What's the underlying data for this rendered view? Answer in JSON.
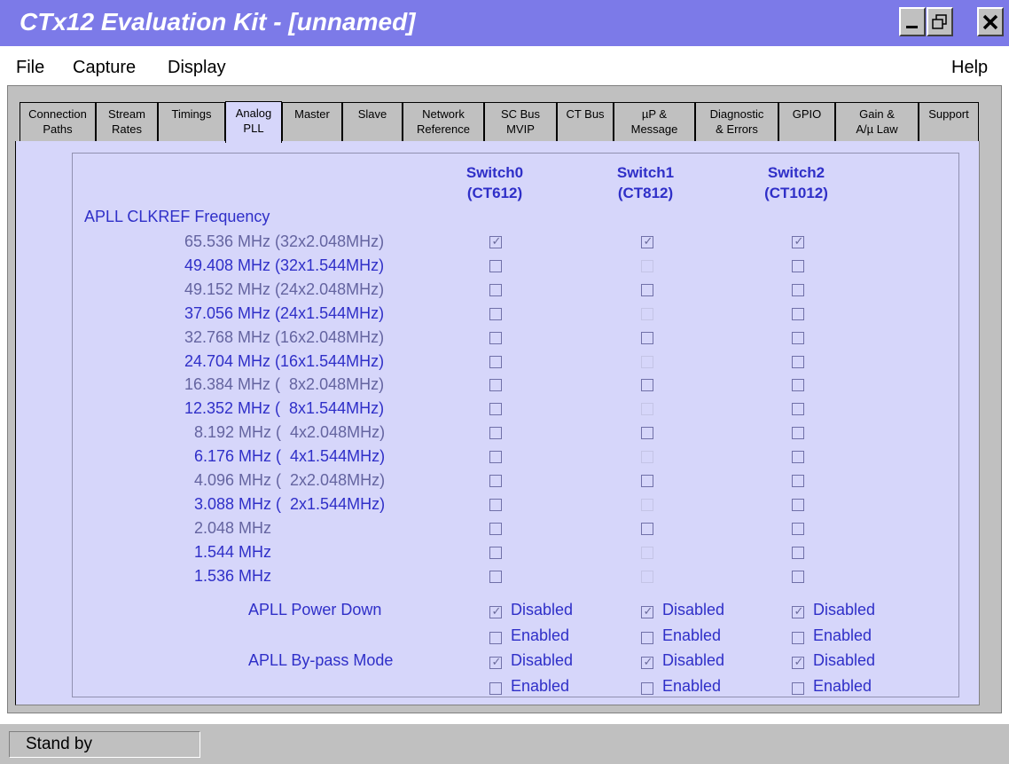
{
  "window": {
    "title": "CTx12 Evaluation Kit - [unnamed]",
    "minimize_icon": "minimize-icon",
    "restore_icon": "restore-icon",
    "close_icon": "close-icon"
  },
  "menu": {
    "file": "File",
    "capture": "Capture",
    "display": "Display",
    "help": "Help"
  },
  "tabs": [
    {
      "label": "Connection\nPaths"
    },
    {
      "label": "Stream\nRates"
    },
    {
      "label": "Timings"
    },
    {
      "label": "Analog\nPLL",
      "active": true
    },
    {
      "label": "Master"
    },
    {
      "label": "Slave"
    },
    {
      "label": "Network\nReference"
    },
    {
      "label": "SC Bus\nMVIP"
    },
    {
      "label": "CT Bus"
    },
    {
      "label": "µP &\nMessage"
    },
    {
      "label": "Diagnostic\n& Errors"
    },
    {
      "label": "GPIO"
    },
    {
      "label": "Gain &\nA/µ Law"
    },
    {
      "label": "Support"
    }
  ],
  "switches": [
    {
      "name": "Switch0",
      "part": "(CT612)"
    },
    {
      "name": "Switch1",
      "part": "(CT812)"
    },
    {
      "name": "Switch2",
      "part": "(CT1012)"
    }
  ],
  "apll": {
    "section_label": "APLL CLKREF Frequency",
    "frequencies": [
      {
        "label": "65.536 MHz (32x2.048MHz)",
        "checked": [
          true,
          true,
          true
        ],
        "disabled_switch1": false
      },
      {
        "label": "49.408 MHz (32x1.544MHz)",
        "checked": [
          false,
          false,
          false
        ],
        "disabled_switch1": true
      },
      {
        "label": "49.152 MHz (24x2.048MHz)",
        "checked": [
          false,
          false,
          false
        ],
        "disabled_switch1": false
      },
      {
        "label": "37.056 MHz (24x1.544MHz)",
        "checked": [
          false,
          false,
          false
        ],
        "disabled_switch1": true
      },
      {
        "label": "32.768 MHz (16x2.048MHz)",
        "checked": [
          false,
          false,
          false
        ],
        "disabled_switch1": false
      },
      {
        "label": "24.704 MHz (16x1.544MHz)",
        "checked": [
          false,
          false,
          false
        ],
        "disabled_switch1": true
      },
      {
        "label": "16.384 MHz (  8x2.048MHz)",
        "checked": [
          false,
          false,
          false
        ],
        "disabled_switch1": false
      },
      {
        "label": "12.352 MHz (  8x1.544MHz)",
        "checked": [
          false,
          false,
          false
        ],
        "disabled_switch1": true
      },
      {
        "label": "8.192 MHz (  4x2.048MHz)",
        "checked": [
          false,
          false,
          false
        ],
        "disabled_switch1": false
      },
      {
        "label": "6.176 MHz (  4x1.544MHz)",
        "checked": [
          false,
          false,
          false
        ],
        "disabled_switch1": true
      },
      {
        "label": "4.096 MHz (  2x2.048MHz)",
        "checked": [
          false,
          false,
          false
        ],
        "disabled_switch1": false
      },
      {
        "label": "3.088 MHz (  2x1.544MHz)",
        "checked": [
          false,
          false,
          false
        ],
        "disabled_switch1": true
      },
      {
        "label": "2.048 MHz",
        "checked": [
          false,
          false,
          false
        ],
        "disabled_switch1": false
      },
      {
        "label": "1.544 MHz",
        "checked": [
          false,
          false,
          false
        ],
        "disabled_switch1": true
      },
      {
        "label": "1.536 MHz",
        "checked": [
          false,
          false,
          false
        ],
        "disabled_switch1": true
      }
    ],
    "power_down": {
      "label": "APLL Power Down",
      "options": [
        "Disabled",
        "Enabled"
      ],
      "selected": [
        "Disabled",
        "Disabled",
        "Disabled"
      ]
    },
    "bypass": {
      "label": "APLL By-pass Mode",
      "options": [
        "Disabled",
        "Enabled"
      ],
      "selected": [
        "Disabled",
        "Disabled",
        "Disabled"
      ]
    }
  },
  "status": {
    "text": "Stand by"
  },
  "colors": {
    "titlebar": "#7c7ae8",
    "panel_bg": "#d6d6fa",
    "label_blue": "#2f2fc8",
    "label_gray": "#6464a0"
  }
}
